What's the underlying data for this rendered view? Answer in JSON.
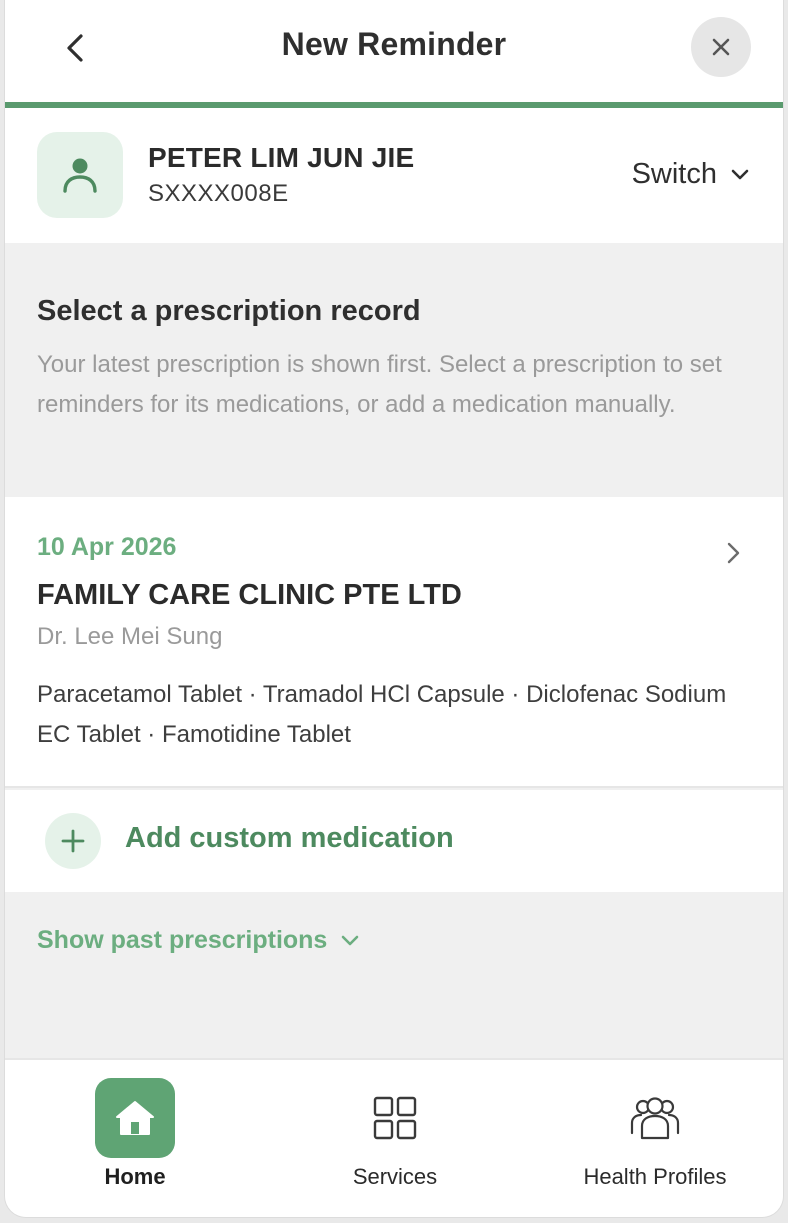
{
  "header": {
    "title": "New Reminder",
    "back_icon": "chevron-left-icon",
    "close_icon": "close-icon"
  },
  "patient": {
    "name": "PETER LIM JUN JIE",
    "id": "SXXXX008E",
    "switch_label": "Switch"
  },
  "intro": {
    "heading": "Select a prescription record",
    "text": "Your latest prescription is shown first. Select a prescription to set reminders for its medications, or add a medication manually."
  },
  "prescription": {
    "date": "10 Apr 2026",
    "clinic": "FAMILY CARE CLINIC PTE LTD",
    "doctor": "Dr. Lee Mei Sung",
    "medications": "Paracetamol Tablet · Tramadol HCl Capsule · Diclofenac Sodium EC Tablet · Famotidine Tablet"
  },
  "add_custom": {
    "label": "Add custom medication"
  },
  "past": {
    "label": "Show past prescriptions"
  },
  "nav": {
    "items": [
      {
        "label": "Home",
        "icon": "home-icon",
        "active": true
      },
      {
        "label": "Services",
        "icon": "grid-icon",
        "active": false
      },
      {
        "label": "Health Profiles",
        "icon": "people-icon",
        "active": false
      }
    ]
  },
  "colors": {
    "accent": "#5fa474",
    "accent_text": "#6cae80",
    "accent_light": "#e5f2e9",
    "progress": "#5a9a6e"
  }
}
